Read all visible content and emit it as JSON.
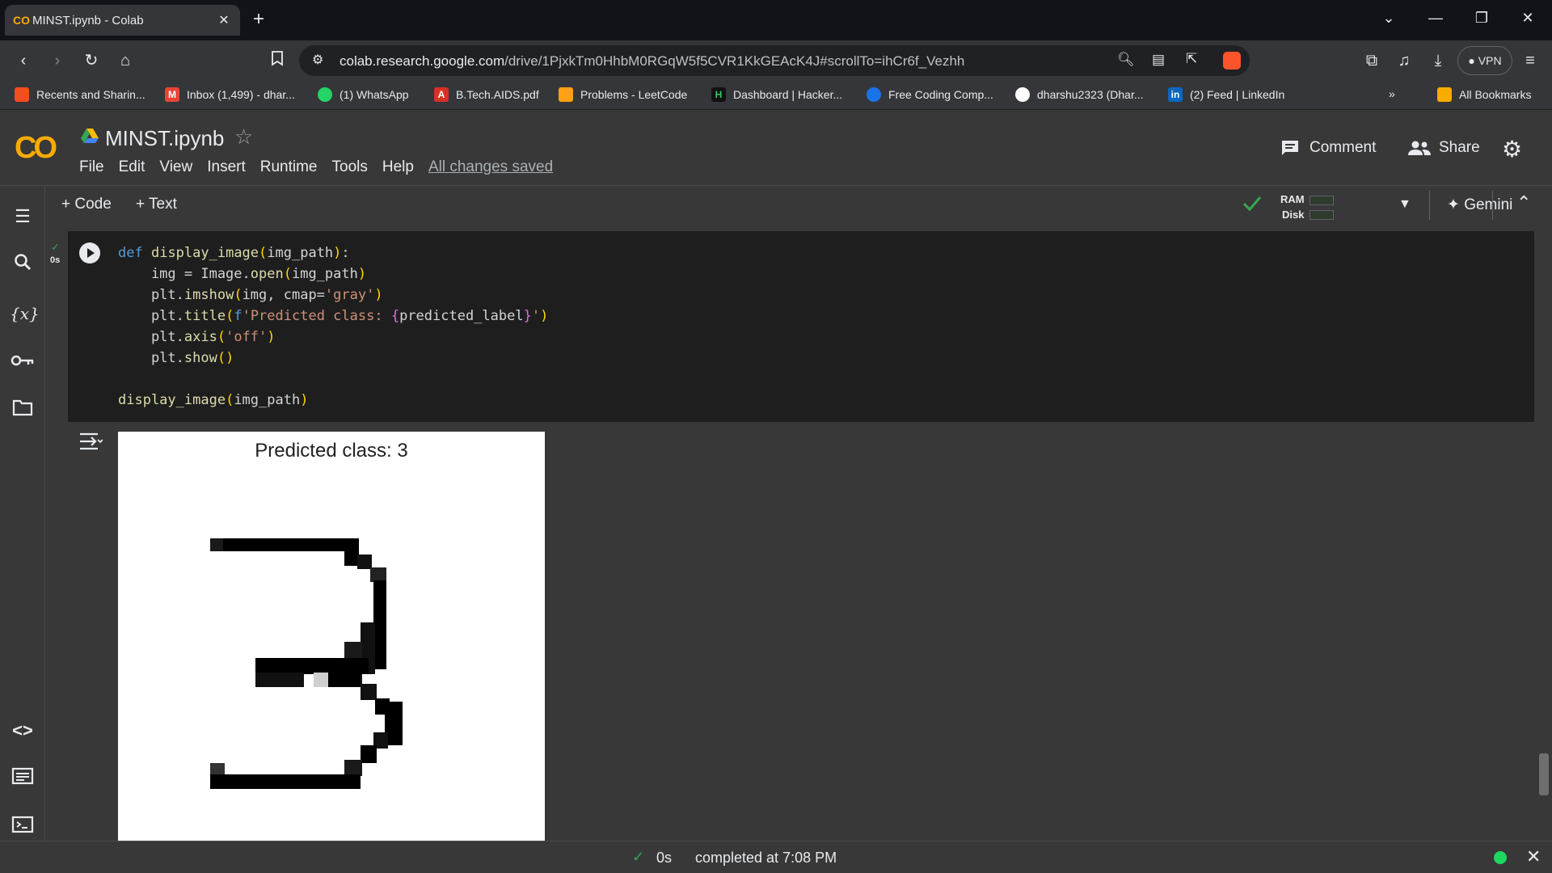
{
  "browser": {
    "tab_title": "MINST.ipynb - Colab",
    "url_host": "colab.research.google.com",
    "url_path": "/drive/1PjxkTm0HhbM0RGqW5f5CVR1KkGEAcK4J#scrollTo=ihCr6f_Vezhh",
    "vpn_label": "VPN",
    "bookmarks": [
      {
        "label": "Recents and Sharin...",
        "color": "#f24e1e",
        "icon": "figma-icon"
      },
      {
        "label": "Inbox (1,499) - dhar...",
        "color": "#ea4335",
        "icon": "gmail-icon"
      },
      {
        "label": "(1) WhatsApp",
        "color": "#25d366",
        "icon": "whatsapp-icon"
      },
      {
        "label": "B.Tech.AIDS.pdf",
        "color": "#d93025",
        "icon": "pdf-icon"
      },
      {
        "label": "Problems - LeetCode",
        "color": "#ffa116",
        "icon": "leetcode-icon"
      },
      {
        "label": "Dashboard | Hacker...",
        "color": "#111111",
        "icon": "hackerrank-icon"
      },
      {
        "label": "Free Coding Comp...",
        "color": "#1a73e8",
        "icon": "codechef-icon"
      },
      {
        "label": "dharshu2323 (Dhar...",
        "color": "#ffffff",
        "icon": "github-icon"
      },
      {
        "label": "(2) Feed | LinkedIn",
        "color": "#0a66c2",
        "icon": "linkedin-icon"
      }
    ],
    "all_bookmarks": "All Bookmarks"
  },
  "colab": {
    "notebook_title": "MINST.ipynb",
    "menu": [
      "File",
      "Edit",
      "View",
      "Insert",
      "Runtime",
      "Tools",
      "Help"
    ],
    "saved_status": "All changes saved",
    "comment_label": "Comment",
    "share_label": "Share",
    "add_code": "+ Code",
    "add_text": "+ Text",
    "ram_label": "RAM",
    "disk_label": "Disk",
    "gemini_label": "Gemini",
    "exec_time": "0s"
  },
  "code_lines": [
    "def display_image(img_path):",
    "    img = Image.open(img_path)",
    "    plt.imshow(img, cmap='gray')",
    "    plt.title(f'Predicted class: {predicted_label}')",
    "    plt.axis('off')",
    "    plt.show()",
    "",
    "display_image(img_path)"
  ],
  "output": {
    "plot_title": "Predicted class: 3"
  },
  "status": {
    "exec_time": "0s",
    "completed": "completed at 7:08 PM"
  },
  "colors": {
    "accent": "#f9ab00",
    "success": "#0f9d58",
    "status_dot": "#1ed760"
  }
}
